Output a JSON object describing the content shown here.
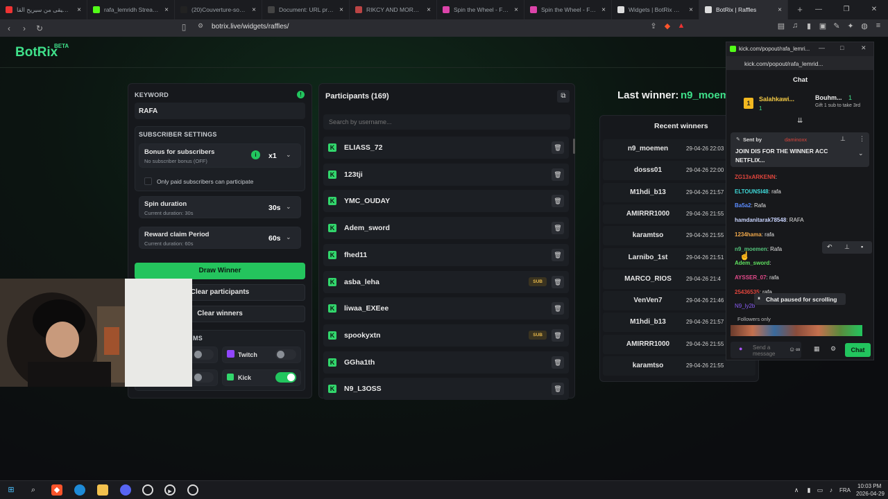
{
  "browser": {
    "tabs": [
      {
        "label": "موسيقى من سيريح القا",
        "color": "#e33",
        "active": false
      },
      {
        "label": "rafa_lemridh Stream - Wat",
        "color": "#53fc18",
        "active": false
      },
      {
        "label": "(20)Couverture-souvenir P",
        "color": "#222",
        "active": false
      },
      {
        "label": "Document: URL property",
        "color": "#444",
        "active": false
      },
      {
        "label": "RIKCY AND MORTY - Brav",
        "color": "#b44",
        "active": false
      },
      {
        "label": "Spin the Wheel - Free Wh",
        "color": "#d4a",
        "active": false
      },
      {
        "label": "Spin the Wheel - Free Wh",
        "color": "#d4a",
        "active": false
      },
      {
        "label": "Widgets | BotRix — Cloud",
        "color": "#ddd",
        "active": false
      },
      {
        "label": "BotRix | Raffles",
        "color": "#ddd",
        "active": true
      }
    ],
    "url": "botrix.live/widgets/raffles/"
  },
  "logo": {
    "name": "BotRix",
    "badge": "BETA"
  },
  "keyword": {
    "label": "KEYWORD",
    "value": "RAFA"
  },
  "subscriber_settings": {
    "title": "SUBSCRIBER SETTINGS",
    "bonus_title": "Bonus for subscribers",
    "bonus_sub": "No subscriber bonus (OFF)",
    "bonus_value": "x1",
    "paid_only": "Only paid subscribers can participate"
  },
  "spin": {
    "title": "Spin duration",
    "sub": "Current duration: 30s",
    "value": "30s"
  },
  "reward": {
    "title": "Reward claim Period",
    "sub": "Current duration: 60s",
    "value": "60s"
  },
  "buttons": {
    "draw": "Draw Winner",
    "clear_participants": "Clear participants",
    "clear_winners": "Clear winners"
  },
  "platforms": {
    "partial_label": "MS",
    "twitch": "Twitch",
    "kick": "Kick",
    "twitch_on": false,
    "kick_on": true
  },
  "participants": {
    "title": "Participants (169)",
    "search_placeholder": "Search by username...",
    "rows": [
      {
        "name": "ELIASS_72",
        "sub": ""
      },
      {
        "name": "123tji",
        "sub": ""
      },
      {
        "name": "YMC_OUDAY",
        "sub": ""
      },
      {
        "name": "Adem_sword",
        "sub": ""
      },
      {
        "name": "fhed11",
        "sub": ""
      },
      {
        "name": "asba_leha",
        "sub": "SUB"
      },
      {
        "name": "liwaa_EXEee",
        "sub": ""
      },
      {
        "name": "spookyxtn",
        "sub": "SUB"
      },
      {
        "name": "GGha1th",
        "sub": ""
      },
      {
        "name": "N9_L3OSS",
        "sub": ""
      }
    ]
  },
  "winners": {
    "last_label": "Last winner:",
    "last_name": "n9_moemen",
    "recent_title": "Recent winners",
    "rows": [
      {
        "name": "n9_moemen",
        "date": "29-04-26 22:03"
      },
      {
        "name": "dosss01",
        "date": "29-04-26 22:00"
      },
      {
        "name": "M1hdi_b13",
        "date": "29-04-26 21:57"
      },
      {
        "name": "AMIRRR1000",
        "date": "29-04-26 21:55"
      },
      {
        "name": "karamtso",
        "date": "29-04-26 21:55"
      },
      {
        "name": "Larnibo_1st",
        "date": "29-04-26 21:51"
      },
      {
        "name": "MARCO_RIOS",
        "date": "29-04-26 21:4"
      },
      {
        "name": "VenVen7",
        "date": "29-04-26 21:46"
      },
      {
        "name": "M1hdi_b13",
        "date": "29-04-26 21:57"
      },
      {
        "name": "AMIRRR1000",
        "date": "29-04-26 21:55"
      },
      {
        "name": "karamtso",
        "date": "29-04-26 21:55"
      }
    ]
  },
  "chat": {
    "url": "kick.com/popout/rafa_lemri...",
    "url2": "kick.com/popout/rafa_lemrid...",
    "title": "Chat",
    "top1_rank": "1",
    "top1_name": "Salahkawi...",
    "top1_count": "1",
    "top2_name": "Bouhm...",
    "top2_count": "1",
    "top2_sub": "Gift 1 sub to take 3rd",
    "pinned_by": "Sent by",
    "pinned_user": "daminoxx",
    "pinned_text": "JOIN DIS FOR THE WINNER ACC NETFLIX...",
    "messages": [
      {
        "user": "ZG13xARKENN",
        "text": "",
        "color": "#e0453c"
      },
      {
        "user": "ELTOUNSI48",
        "text": "rafa",
        "color": "#3fd9d9"
      },
      {
        "user": "Ba5a2",
        "text": "Rafa",
        "color": "#5b8cff"
      },
      {
        "user": "hamdanitarak78548",
        "text": "RAFA",
        "color": "#c9d4ff"
      },
      {
        "user": "1234hama",
        "text": "rafa",
        "color": "#f0a84a"
      },
      {
        "user": "n9_moemen",
        "text": "Rafa",
        "color": "#53c27a"
      },
      {
        "user": "Adem_sword",
        "text": "",
        "color": "#5fe05f"
      },
      {
        "user": "AYSSER_07",
        "text": "rafa",
        "color": "#e24a8a"
      },
      {
        "user": "25436535",
        "text": "rafa",
        "color": "#e0453c"
      }
    ],
    "last_partial": "N9_ly2b",
    "paused": "Chat paused for scrolling",
    "followers_only": "Followers only",
    "send_placeholder": "Send a message",
    "send_btn": "Chat"
  },
  "taskbar": {
    "lang": "FRA",
    "time": "10:03 PM",
    "date": "2026-04-29"
  }
}
